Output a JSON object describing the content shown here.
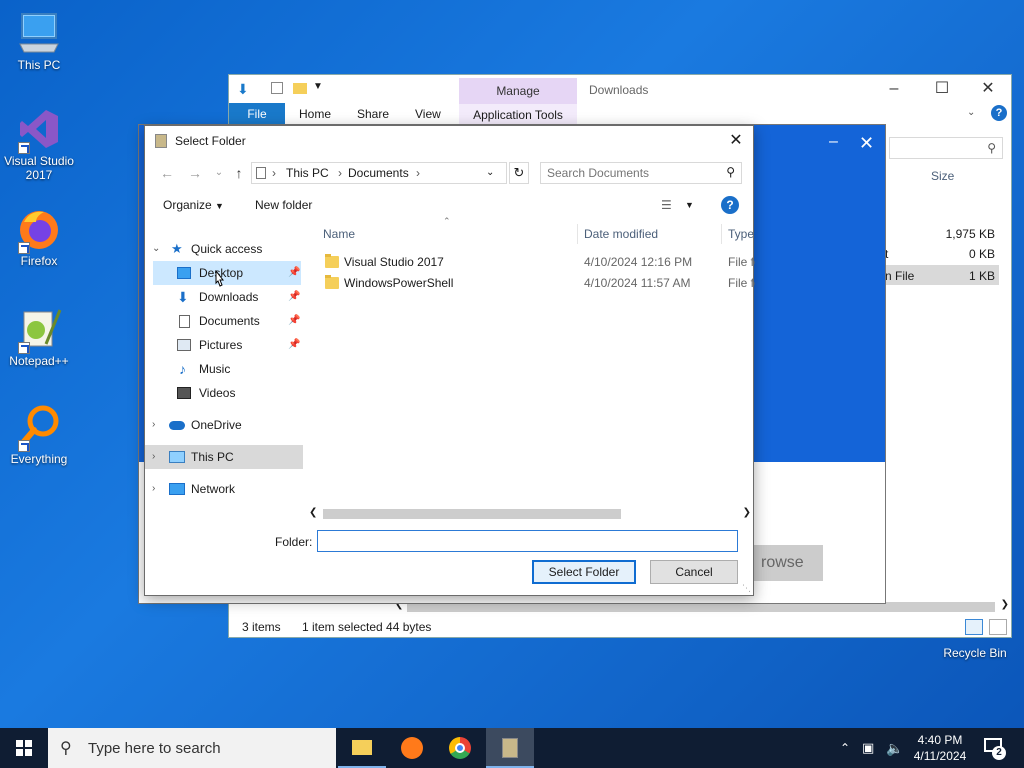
{
  "desktop": {
    "icons": [
      {
        "label": "This PC"
      },
      {
        "label": "Visual Studio 2017"
      },
      {
        "label": "Firefox"
      },
      {
        "label": "Notepad++"
      },
      {
        "label": "Everything"
      },
      {
        "label": "Recycle Bin"
      }
    ]
  },
  "explorer": {
    "title": "Downloads",
    "tabs": {
      "file": "File",
      "home": "Home",
      "share": "Share",
      "view": "View",
      "manage": "Manage",
      "app_tools": "Application Tools"
    },
    "size_header": "Size",
    "sizes": [
      "1,975 KB",
      "0 KB",
      "1 KB"
    ],
    "partial_types": [
      "t",
      "n File"
    ],
    "status": {
      "items": "3 items",
      "selected": "1 item selected  44 bytes"
    }
  },
  "blue_app": {
    "browse_label": "rowse"
  },
  "dialog": {
    "title": "Select Folder",
    "breadcrumb": [
      "This PC",
      "Documents"
    ],
    "search_placeholder": "Search Documents",
    "organize": "Organize",
    "new_folder": "New folder",
    "nav": {
      "quick_access": "Quick access",
      "desktop": "Desktop",
      "downloads": "Downloads",
      "documents": "Documents",
      "pictures": "Pictures",
      "music": "Music",
      "videos": "Videos",
      "onedrive": "OneDrive",
      "this_pc": "This PC",
      "network": "Network"
    },
    "columns": {
      "name": "Name",
      "date": "Date modified",
      "type": "Type"
    },
    "files": [
      {
        "name": "Visual Studio 2017",
        "date": "4/10/2024 12:16 PM",
        "type": "File fo"
      },
      {
        "name": "WindowsPowerShell",
        "date": "4/10/2024 11:57 AM",
        "type": "File fo"
      }
    ],
    "folder_label": "Folder:",
    "folder_value": "",
    "select_btn": "Select Folder",
    "cancel_btn": "Cancel"
  },
  "taskbar": {
    "search_placeholder": "Type here to search",
    "time": "4:40 PM",
    "date": "4/11/2024",
    "notifications": "2"
  },
  "colors": {
    "accent": "#1979ca",
    "desktop": "#0a62c9",
    "blue_panel": "#1464d8"
  }
}
